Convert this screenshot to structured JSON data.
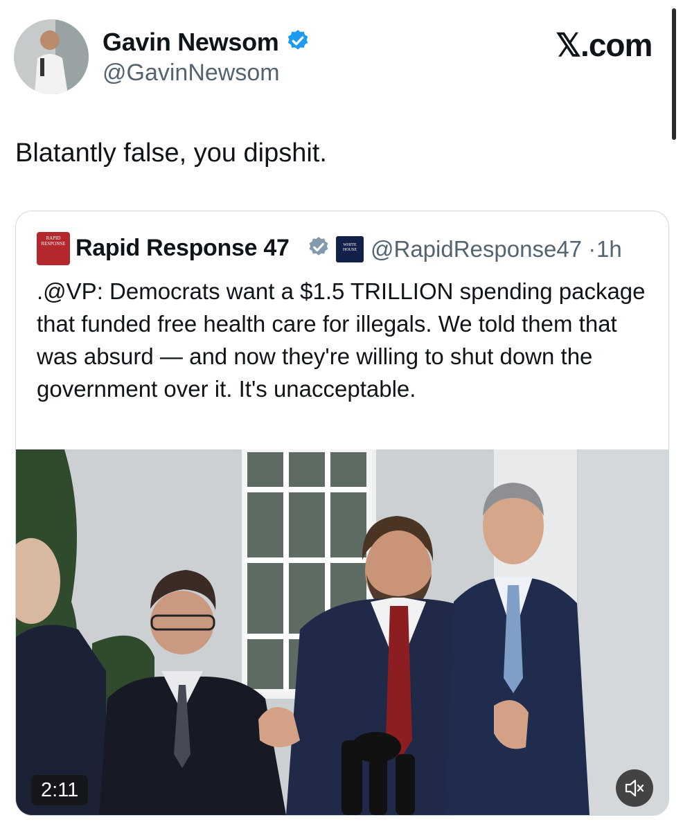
{
  "author": {
    "name": "Gavin Newsom",
    "handle": "@GavinNewsom",
    "verified_color": "#1d9bf0"
  },
  "brand": {
    "logo_text": "𝕏.com"
  },
  "tweet": {
    "text": "Blatantly false, you dipshit."
  },
  "quote": {
    "avatar_text": "RAPID RESPONSE",
    "name": "Rapid Response 47",
    "verified_color": "#829aab",
    "affiliate_badge_text": "WHITE HOUSE",
    "handle": "@RapidResponse47",
    "separator": "·",
    "time": "1h",
    "text": ".@VP: Democrats want a $1.5 TRILLION spending package that funded free health care for illegals. We told them that was absurd — and now they're willing to shut down the government over it. It's unacceptable.",
    "media": {
      "duration": "2:11",
      "mute_icon": "speaker-muted-icon"
    }
  }
}
